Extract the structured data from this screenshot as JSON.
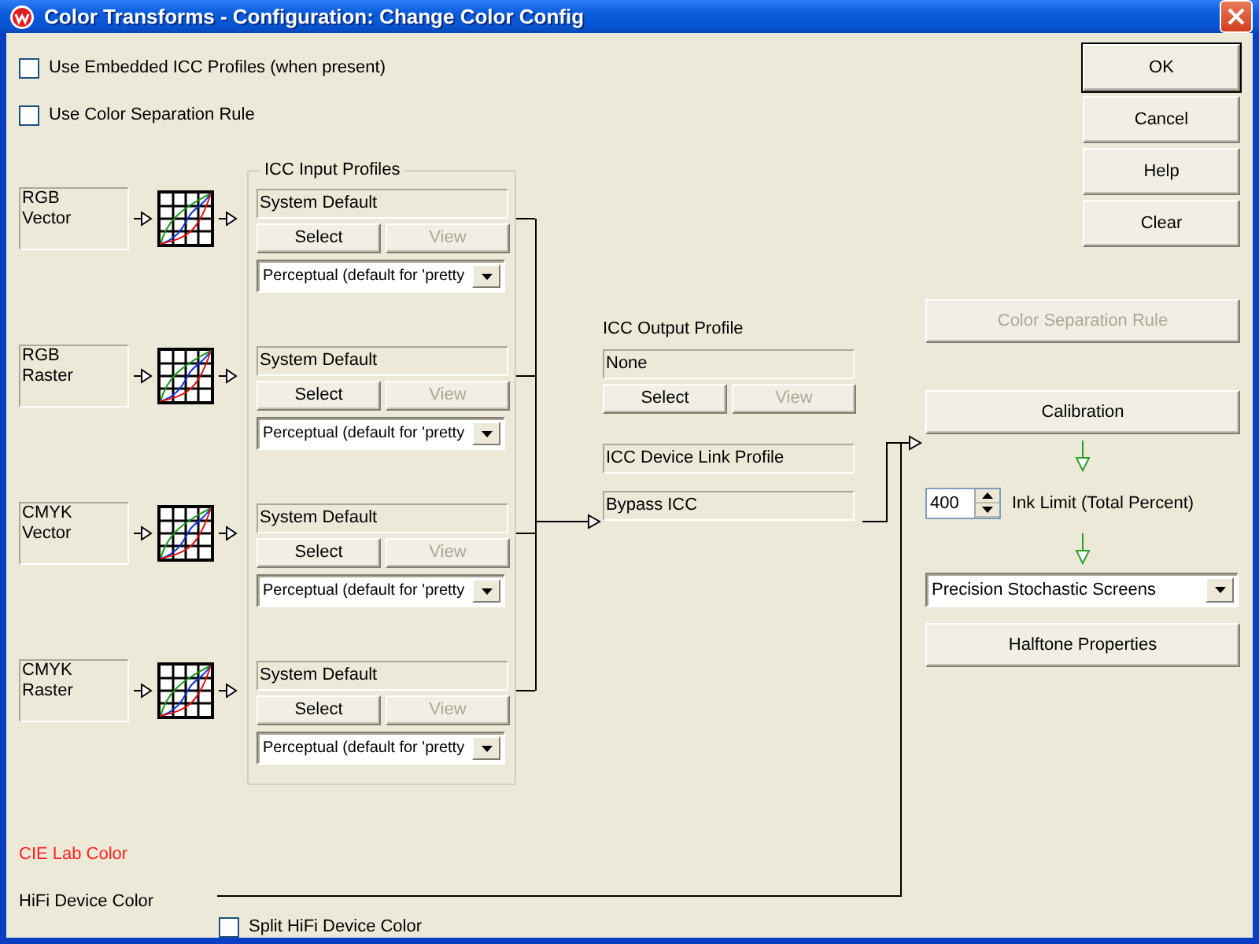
{
  "window": {
    "title": "Color Transforms - Configuration: Change Color Config"
  },
  "options": [
    {
      "label": "Use Embedded ICC Profiles (when present)",
      "checked": false
    },
    {
      "label": "Use Color Separation Rule",
      "checked": false
    }
  ],
  "dialog_buttons": [
    {
      "label": "OK",
      "default": true
    },
    {
      "label": "Cancel",
      "default": false
    },
    {
      "label": "Help",
      "default": false
    },
    {
      "label": "Clear",
      "default": false
    }
  ],
  "sources": [
    {
      "label": "RGB\nVector"
    },
    {
      "label": "RGB\nRaster"
    },
    {
      "label": "CMYK\nVector"
    },
    {
      "label": "CMYK\nRaster"
    }
  ],
  "input_profiles": {
    "legend": "ICC Input Profiles",
    "items": [
      {
        "profile": "System Default",
        "buttons": [
          {
            "label": "Select",
            "disabled": false
          },
          {
            "label": "View",
            "disabled": true
          }
        ],
        "intent": "Perceptual (default for 'pretty"
      },
      {
        "profile": "System Default",
        "buttons": [
          {
            "label": "Select",
            "disabled": false
          },
          {
            "label": "View",
            "disabled": true
          }
        ],
        "intent": "Perceptual (default for 'pretty"
      },
      {
        "profile": "System Default",
        "buttons": [
          {
            "label": "Select",
            "disabled": false
          },
          {
            "label": "View",
            "disabled": true
          }
        ],
        "intent": "Perceptual (default for 'pretty"
      },
      {
        "profile": "System Default",
        "buttons": [
          {
            "label": "Select",
            "disabled": false
          },
          {
            "label": "View",
            "disabled": true
          }
        ],
        "intent": "Perceptual (default for 'pretty"
      }
    ]
  },
  "output_profile": {
    "label": "ICC Output Profile",
    "profile": "None",
    "buttons": [
      {
        "label": "Select",
        "disabled": false
      },
      {
        "label": "View",
        "disabled": true
      }
    ]
  },
  "device_link": {
    "label": "ICC Device Link Profile",
    "value": "Bypass ICC"
  },
  "separation_button": {
    "label": "Color Separation Rule",
    "disabled": true
  },
  "calibration_button": {
    "label": "Calibration",
    "disabled": false
  },
  "ink_limit": {
    "value": "400",
    "label": "Ink Limit (Total Percent)"
  },
  "screening": {
    "value": "Precision Stochastic Screens"
  },
  "halftone_button": {
    "label": "Halftone Properties",
    "disabled": false
  },
  "cie_label": "CIE Lab Color",
  "hifi_label": "HiFi Device Color",
  "split_option": {
    "label": "Split HiFi Device Color",
    "checked": false
  }
}
